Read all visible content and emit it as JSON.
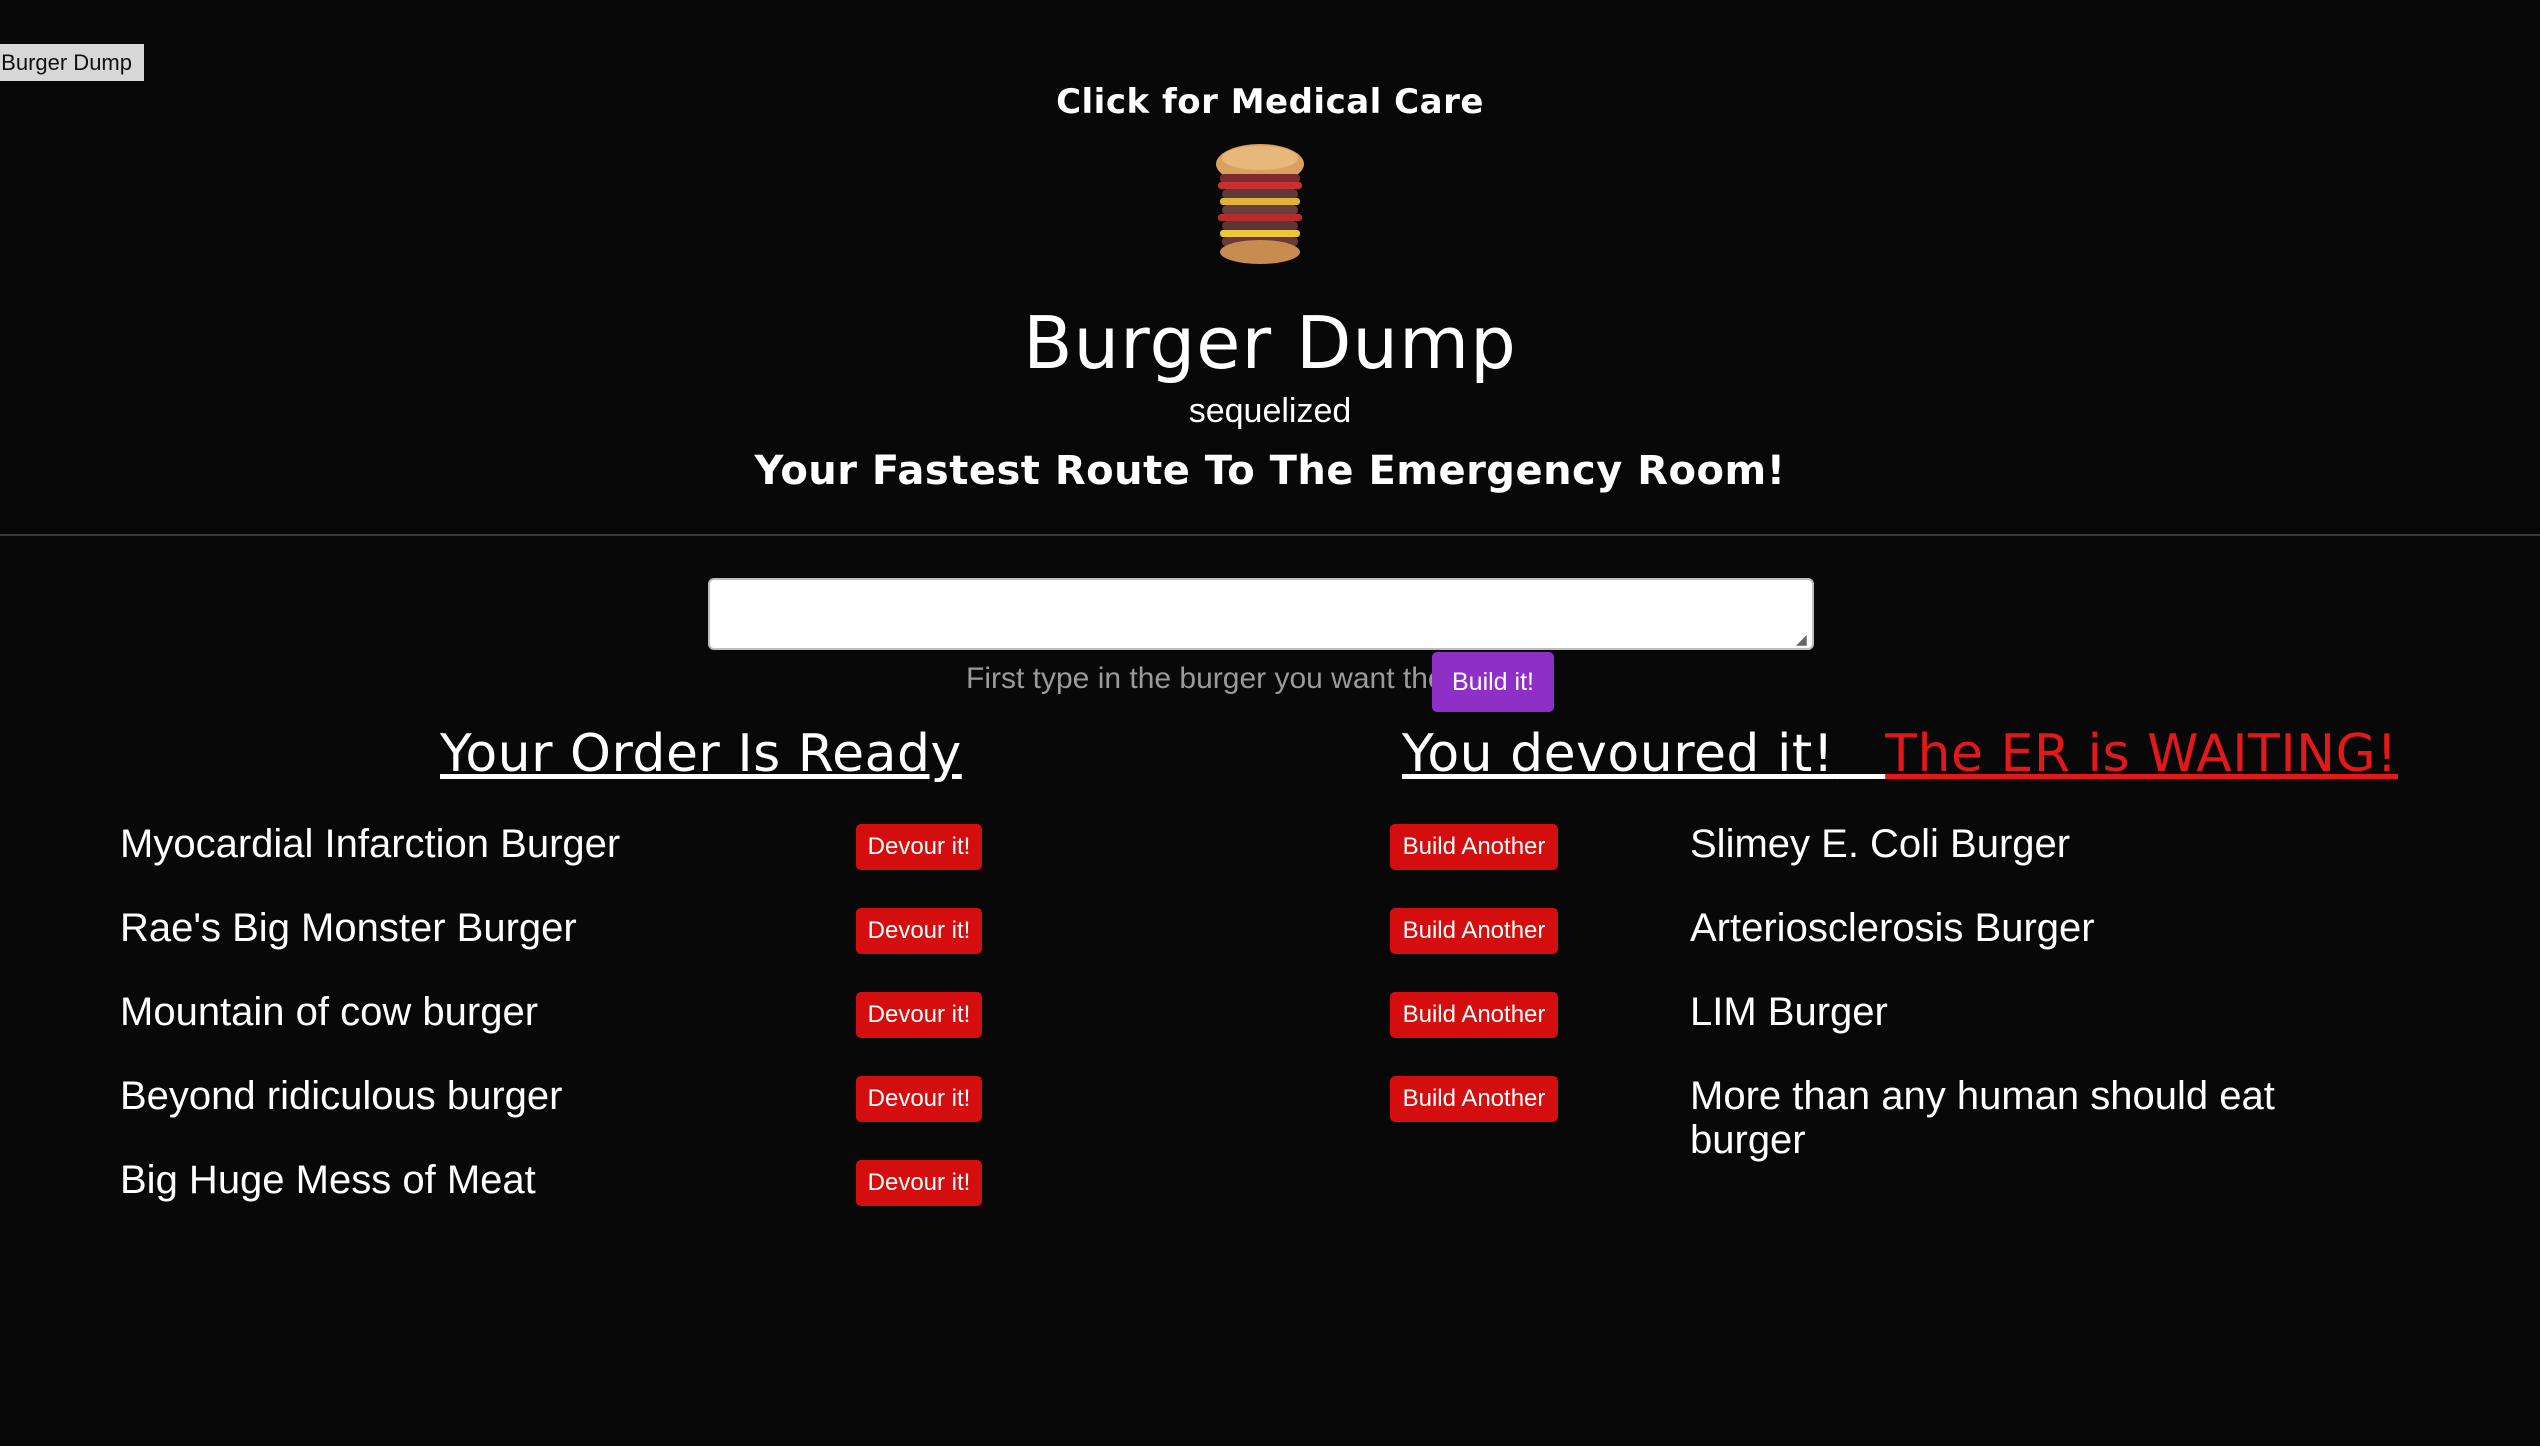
{
  "corner_tab": {
    "label": "Burger Dump"
  },
  "header": {
    "medical_link": "Click for Medical Care",
    "logo_icon": "burger-stack-icon",
    "title": "Burger Dump",
    "subtitle": "sequelized",
    "tagline": "Your Fastest Route To The Emergency Room!"
  },
  "form": {
    "input_value": "",
    "hint": "First type in the burger you want then",
    "build_label": "Build it!"
  },
  "columns": {
    "ready_heading": "Your Order Is Ready",
    "devoured_heading": "You devoured it!",
    "er_heading": "The ER is WAITING!"
  },
  "ready": [
    {
      "name": "Myocardial Infarction Burger",
      "button": "Devour it!"
    },
    {
      "name": "Rae's Big Monster Burger",
      "button": "Devour it!"
    },
    {
      "name": "Mountain of cow burger",
      "button": "Devour it!"
    },
    {
      "name": "Beyond ridiculous burger",
      "button": "Devour it!"
    },
    {
      "name": "Big Huge Mess of Meat",
      "button": "Devour it!"
    }
  ],
  "devoured": [
    {
      "name": "Slimey E. Coli Burger",
      "button": "Build Another"
    },
    {
      "name": "Arteriosclerosis Burger",
      "button": "Build Another"
    },
    {
      "name": "LIM Burger",
      "button": "Build Another"
    },
    {
      "name": "More than any human should eat burger",
      "button": "Build Another"
    }
  ],
  "colors": {
    "background": "#080808",
    "action_red": "#d40e0e",
    "build_purple": "#8e2fc8",
    "er_red": "#e31818"
  }
}
